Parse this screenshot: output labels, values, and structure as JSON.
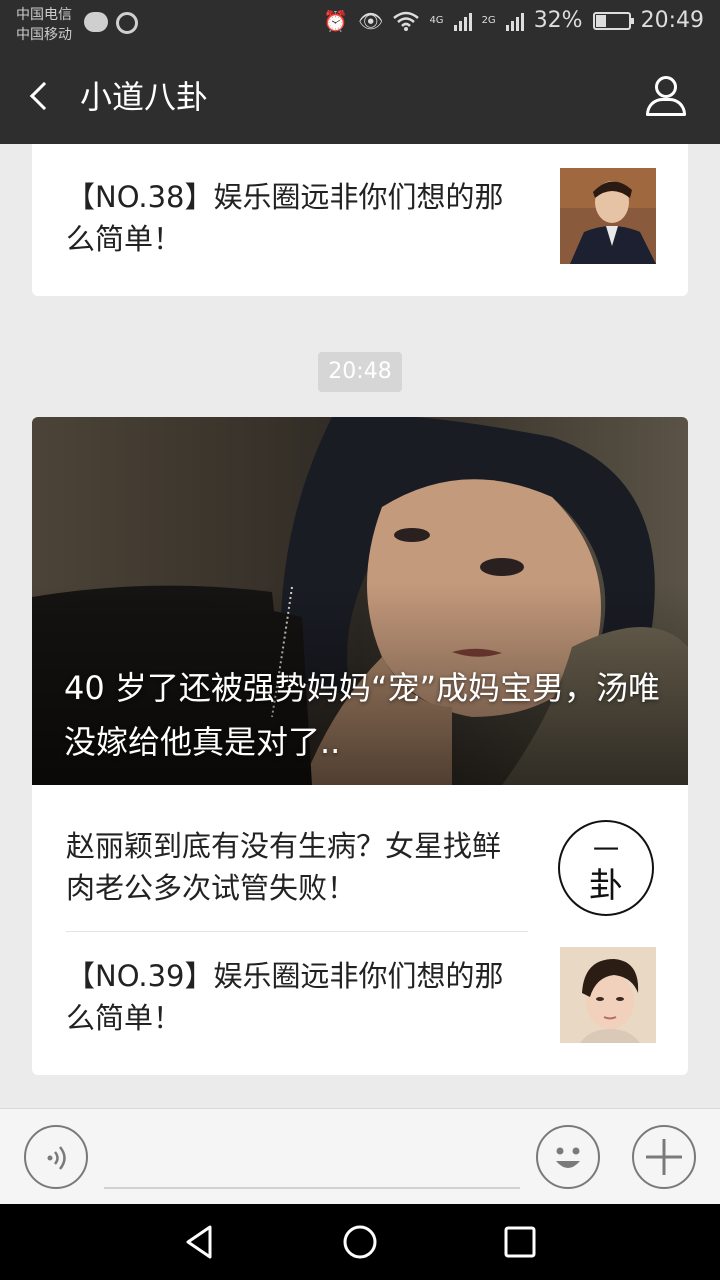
{
  "status_bar": {
    "carrier_1": "中国电信",
    "carrier_2": "中国移动",
    "network_4g": "4G",
    "network_2g": "2G",
    "battery": "32%",
    "battery_level": 0.32,
    "time": "20:49"
  },
  "header": {
    "title": "小道八卦",
    "back_icon": "chevron-left-icon",
    "profile_icon": "person-icon"
  },
  "messages": {
    "top_card": {
      "article_title": "【NO.38】娱乐圈远非你们想的那么简单！"
    },
    "timestamp": "20:48",
    "main_card": {
      "hero_title": "40 岁了还被强势妈妈“宠”成妈宝男，汤唯没嫁给他真是对了..",
      "items": [
        {
          "title": "赵丽颖到底有没有生病？女星找鲜肉老公多次试管失败！",
          "logo_line1": "一",
          "logo_line2": "卦"
        },
        {
          "title": "【NO.39】娱乐圈远非你们想的那么简单！"
        }
      ]
    }
  },
  "input_bar": {
    "voice_icon": "voice-icon",
    "emoji_icon": "smile-icon",
    "plus_icon": "plus-icon",
    "placeholder": ""
  },
  "system_nav": {
    "back": "triangle-back-icon",
    "home": "circle-home-icon",
    "recents": "square-recents-icon"
  },
  "colors": {
    "bar": "#2e2e2e",
    "background": "#ebebeb",
    "card": "#ffffff"
  }
}
